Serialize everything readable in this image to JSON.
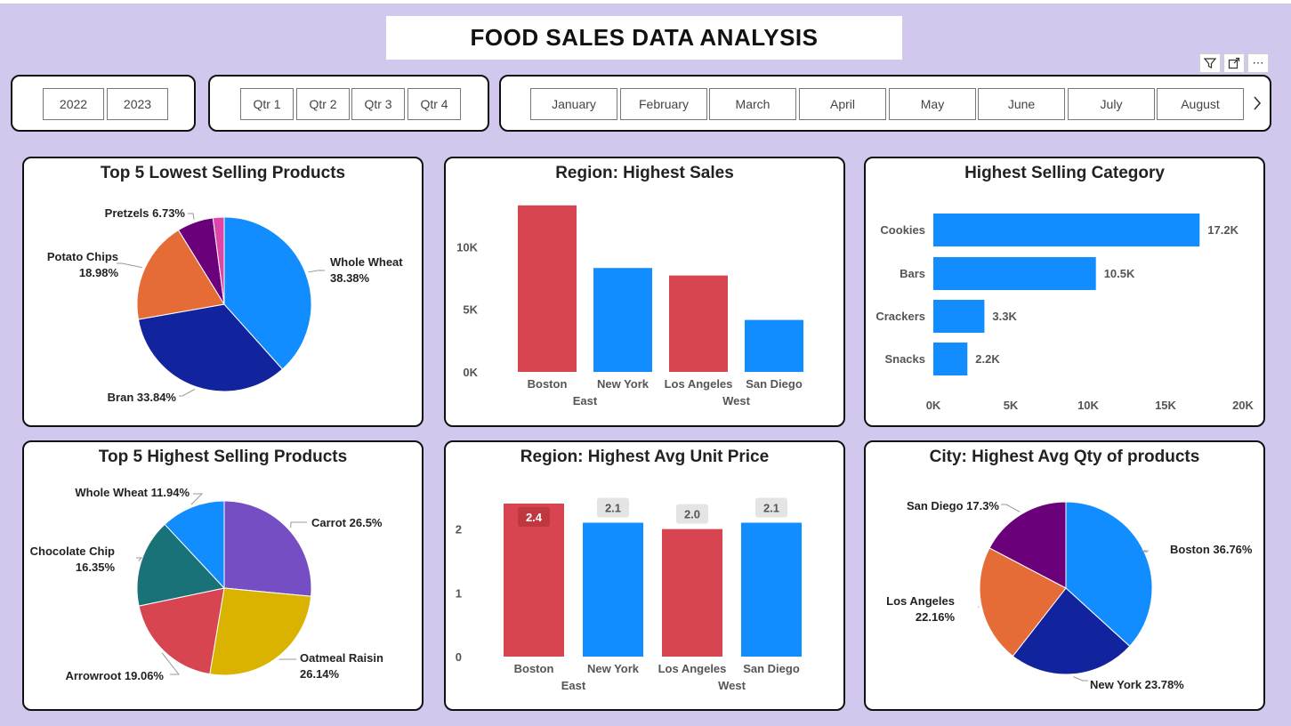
{
  "title": "FOOD SALES DATA ANALYSIS",
  "visual_header_icons": [
    "filter-icon",
    "focus-mode-icon",
    "more-options-icon"
  ],
  "slicers": {
    "years": [
      "2022",
      "2023"
    ],
    "quarters": [
      "Qtr 1",
      "Qtr 2",
      "Qtr 3",
      "Qtr 4"
    ],
    "months": [
      "January",
      "February",
      "March",
      "April",
      "May",
      "June",
      "July",
      "August"
    ]
  },
  "charts": {
    "lowest_products": {
      "title": "Top 5 Lowest Selling Products"
    },
    "region_sales": {
      "title": "Region: Highest Sales"
    },
    "category": {
      "title": "Highest Selling Category"
    },
    "highest_products": {
      "title": "Top 5 Highest Selling Products"
    },
    "region_price": {
      "title": "Region: Highest Avg Unit Price"
    },
    "city_qty": {
      "title": "City: Highest Avg Qty of products"
    }
  },
  "chart_data": [
    {
      "type": "pie",
      "title": "Top 5 Lowest Selling Products",
      "slices": [
        {
          "label": "Whole Wheat",
          "pct_label": "38.38%",
          "value": 38.38,
          "color": "#118dff"
        },
        {
          "label": "Bran",
          "pct_label": "33.84%",
          "value": 33.84,
          "color": "#12239e"
        },
        {
          "label": "Potato Chips",
          "pct_label": "18.98%",
          "value": 18.98,
          "color": "#e66c37"
        },
        {
          "label": "Pretzels",
          "pct_label": "6.73%",
          "value": 6.73,
          "color": "#6b007b"
        },
        {
          "label": "",
          "pct_label": "",
          "value": 2.07,
          "color": "#e044a7"
        }
      ]
    },
    {
      "type": "bar",
      "title": "Region: Highest Sales",
      "categories": [
        "Boston",
        "New York",
        "Los Angeles",
        "San Diego"
      ],
      "groups": [
        {
          "label": "East",
          "span": [
            0,
            1
          ]
        },
        {
          "label": "West",
          "span": [
            2,
            3
          ]
        }
      ],
      "values": [
        13300,
        8300,
        7700,
        4150
      ],
      "colors": [
        "#d64550",
        "#118dff",
        "#d64550",
        "#118dff"
      ],
      "yticks": [
        "0K",
        "5K",
        "10K"
      ],
      "ylim": [
        0,
        14000
      ]
    },
    {
      "type": "bar",
      "orientation": "horizontal",
      "title": "Highest Selling Category",
      "categories": [
        "Cookies",
        "Bars",
        "Crackers",
        "Snacks"
      ],
      "values": [
        17200,
        10500,
        3300,
        2200
      ],
      "data_labels": [
        "17.2K",
        "10.5K",
        "3.3K",
        "2.2K"
      ],
      "color": "#118dff",
      "xticks": [
        "0K",
        "5K",
        "10K",
        "15K",
        "20K"
      ],
      "xlim": [
        0,
        20000
      ]
    },
    {
      "type": "pie",
      "title": "Top 5 Highest Selling Products",
      "slices": [
        {
          "label": "Carrot",
          "pct_label": "26.5%",
          "value": 26.5,
          "color": "#744ec2"
        },
        {
          "label": "Oatmeal Raisin",
          "pct_label": "26.14%",
          "value": 26.14,
          "color": "#d9b300"
        },
        {
          "label": "Arrowroot",
          "pct_label": "19.06%",
          "value": 19.06,
          "color": "#d64550"
        },
        {
          "label": "Chocolate Chip",
          "pct_label": "16.35%",
          "value": 16.35,
          "color": "#197278"
        },
        {
          "label": "Whole Wheat",
          "pct_label": "11.94%",
          "value": 11.94,
          "color": "#118dff"
        }
      ]
    },
    {
      "type": "bar",
      "title": "Region: Highest Avg Unit Price",
      "categories": [
        "Boston",
        "New York",
        "Los Angeles",
        "San Diego"
      ],
      "groups": [
        {
          "label": "East",
          "span": [
            0,
            1
          ]
        },
        {
          "label": "West",
          "span": [
            2,
            3
          ]
        }
      ],
      "values": [
        2.4,
        2.1,
        2.0,
        2.1
      ],
      "data_labels": [
        "2.4",
        "2.1",
        "2.0",
        "2.1"
      ],
      "colors": [
        "#d64550",
        "#118dff",
        "#d64550",
        "#118dff"
      ],
      "yticks": [
        "0",
        "1",
        "2"
      ],
      "ylim": [
        0,
        2.4
      ]
    },
    {
      "type": "pie",
      "title": "City: Highest Avg Qty of products",
      "slices": [
        {
          "label": "Boston",
          "pct_label": "36.76%",
          "value": 36.76,
          "color": "#118dff"
        },
        {
          "label": "New York",
          "pct_label": "23.78%",
          "value": 23.78,
          "color": "#12239e"
        },
        {
          "label": "Los Angeles",
          "pct_label": "22.16%",
          "value": 22.16,
          "color": "#e66c37"
        },
        {
          "label": "San Diego",
          "pct_label": "17.3%",
          "value": 17.3,
          "color": "#6b007b"
        }
      ]
    }
  ]
}
